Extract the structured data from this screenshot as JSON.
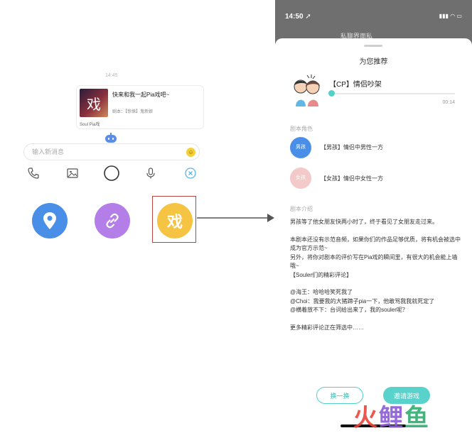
{
  "chat": {
    "time": "14:45",
    "card": {
      "cover_glyph": "戏",
      "title": "快来和我一起Pia戏吧~",
      "subtitle": "剧本：【惊悚】鬼新娘",
      "source": "Soul Pia戏"
    },
    "input": {
      "placeholder": "输入新消息",
      "value": ""
    },
    "tools": [
      "phone-icon",
      "image-icon",
      "circle-icon",
      "mic-icon",
      "close-circle-icon"
    ],
    "actions": {
      "location_color": "#4a8fe7",
      "link_color": "#b37ee8",
      "pia_color": "#f5c443",
      "pia_label": "戏"
    }
  },
  "phone": {
    "status_time": "14:50 ➚",
    "status_icons": "▮▮▮ ◠ ▭",
    "nav_title": "私聊界面私",
    "sheet_title": "为您推荐",
    "script": {
      "name": "【CP】情侣吵架",
      "duration": "00:14",
      "progress": 0.0
    },
    "roles_label": "剧本角色",
    "roles": [
      {
        "badge": "男孩",
        "desc": "【男孩】情侣中男性一方",
        "color": "#4a8fe7"
      },
      {
        "badge": "女孩",
        "desc": "【女孩】情侣中女性一方",
        "color": "#f3c9c9"
      }
    ],
    "intro_label": "剧本介绍",
    "intro_paragraphs": [
      "男孩等了他女朋友快两小时了，终于看见了女朋友走过来。",
      "本剧本还没有示范音频，如果你们的作品足够优质，将有机会被选中成为官方示范~\n另外，将你对剧本的评价写在Pia戏的瞬间里，有很大的机会能上墙哦~\n【Souler们的精彩评论】",
      "@海王：哈哈哈笑死我了\n@Choi：我要我的大猪蹄子pia一下，他敢骂我我就死定了\n@横着放不下：台词给出来了，我的souler呢？",
      "更多精彩评论正在筛选中……"
    ],
    "buttons": {
      "refresh": "换一换",
      "invite": "邀请游戏"
    }
  },
  "watermark": {
    "text": "火鲤鱼",
    "colors": [
      "#e8453c",
      "#8a5bd6",
      "#2fae6e"
    ]
  }
}
